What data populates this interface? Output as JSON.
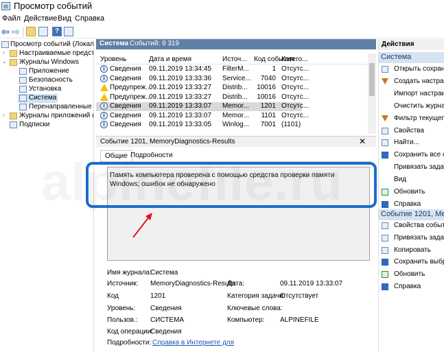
{
  "window": {
    "title": "Просмотр событий"
  },
  "menu": [
    "Файл",
    "Действие",
    "Вид",
    "Справка"
  ],
  "tree": [
    {
      "label": "Просмотр событий (Локальны",
      "level": 0,
      "expander": "",
      "icon": "event-viewer"
    },
    {
      "label": "Настраиваемые представле",
      "level": 1,
      "expander": "›",
      "icon": "folder"
    },
    {
      "label": "Журналы Windows",
      "level": 1,
      "expander": "⌄",
      "icon": "folder"
    },
    {
      "label": "Приложение",
      "level": 2,
      "expander": "",
      "icon": "log"
    },
    {
      "label": "Безопасность",
      "level": 2,
      "expander": "",
      "icon": "log"
    },
    {
      "label": "Установка",
      "level": 2,
      "expander": "",
      "icon": "log"
    },
    {
      "label": "Система",
      "level": 2,
      "expander": "",
      "icon": "log",
      "selected": true
    },
    {
      "label": "Перенаправленные собы",
      "level": 2,
      "expander": "",
      "icon": "log"
    },
    {
      "label": "Журналы приложений и сл",
      "level": 1,
      "expander": "›",
      "icon": "folder"
    },
    {
      "label": "Подписки",
      "level": 1,
      "expander": "",
      "icon": "subscription"
    }
  ],
  "middle": {
    "title": "Система",
    "count_label": "Событий: 9 319"
  },
  "grid": {
    "columns": [
      "Уровень",
      "Дата и время",
      "Источ...",
      "Код события",
      "Катего..."
    ],
    "rows": [
      {
        "level": "Сведения",
        "icon": "info",
        "date": "09.11.2019 13:34:45",
        "source": "FilterM...",
        "code": "1",
        "category": "Отсутс..."
      },
      {
        "level": "Сведения",
        "icon": "info",
        "date": "09.11.2019 13:33:36",
        "source": "Service...",
        "code": "7040",
        "category": "Отсутс..."
      },
      {
        "level": "Предупреж...",
        "icon": "warning",
        "date": "09.11.2019 13:33:27",
        "source": "Distrib...",
        "code": "10016",
        "category": "Отсутс..."
      },
      {
        "level": "Предупреж...",
        "icon": "warning",
        "date": "09.11.2019 13:33:27",
        "source": "Distrib...",
        "code": "10016",
        "category": "Отсутс..."
      },
      {
        "level": "Сведения",
        "icon": "info",
        "date": "09.11.2019 13:33:07",
        "source": "Memor...",
        "code": "1201",
        "category": "Отсутс...",
        "selected": true
      },
      {
        "level": "Сведения",
        "icon": "info",
        "date": "09.11.2019 13:33:07",
        "source": "Memor...",
        "code": "1101",
        "category": "Отсутс..."
      },
      {
        "level": "Сведения",
        "icon": "info",
        "date": "09.11.2019 13:33:05",
        "source": "Winlog...",
        "code": "7001",
        "category": "(1101)"
      }
    ]
  },
  "detail": {
    "title": "Событие 1201, MemoryDiagnostics-Results",
    "close": "✕",
    "tabs": [
      "Общие",
      "Подробности"
    ],
    "message": "Память компьютера проверена с помощью средства проверки памяти Windows; ошибок не обнаружено",
    "props": {
      "log_name_label": "Имя журнала:",
      "log_name": "Система",
      "source_label": "Источник:",
      "source": "MemoryDiagnostics-Results",
      "date_label": "Дата:",
      "date": "09.11.2019 13:33:07",
      "code_label": "Код",
      "code": "1201",
      "task_label": "Категория задачи:",
      "task": "Отсутствует",
      "level_label": "Уровень:",
      "level": "Сведения",
      "keywords_label": "Ключевые слова:",
      "keywords": "",
      "user_label": "Пользов.:",
      "user": "СИСТЕМА",
      "computer_label": "Компьютер:",
      "computer": "ALPINEFILE",
      "opcode_label": "Код операции:",
      "opcode": "Сведения",
      "more_label": "Подробности:",
      "more_link": "Справка в Интернете для"
    }
  },
  "watermark": "alpinefile.ru",
  "actions": {
    "header": "Действия",
    "section1": "Система",
    "items1": [
      {
        "label": "Открыть сохранен",
        "icon": "open-icon"
      },
      {
        "label": "Создать настраива",
        "icon": "filter-icon"
      },
      {
        "label": "Импорт настраива",
        "icon": "blank"
      },
      {
        "label": "Очистить журнал...",
        "icon": "blank"
      },
      {
        "label": "Фильтр текущего ж",
        "icon": "filter-icon"
      },
      {
        "label": "Свойства",
        "icon": "properties-icon"
      },
      {
        "label": "Найти...",
        "icon": "find-icon"
      },
      {
        "label": "Сохранить все соб",
        "icon": "save-icon"
      },
      {
        "label": "Привязать задачу к",
        "icon": "blank"
      },
      {
        "label": "Вид",
        "icon": "blank"
      },
      {
        "label": "Обновить",
        "icon": "refresh-icon"
      },
      {
        "label": "Справка",
        "icon": "help-icon"
      }
    ],
    "section2": "Событие 1201, Mem",
    "items2": [
      {
        "label": "Свойства событий",
        "icon": "properties-icon"
      },
      {
        "label": "Привязать задачу к",
        "icon": "task-icon"
      },
      {
        "label": "Копировать",
        "icon": "copy-icon"
      },
      {
        "label": "Сохранить выбран",
        "icon": "save-icon"
      },
      {
        "label": "Обновить",
        "icon": "refresh-icon"
      },
      {
        "label": "Справка",
        "icon": "help-icon"
      }
    ]
  },
  "colors": {
    "panel_header": "#5f7fa6",
    "highlight": "#1a6ec8",
    "annotation_arrow": "#e0141e",
    "section_bg": "#d6e2f1"
  }
}
